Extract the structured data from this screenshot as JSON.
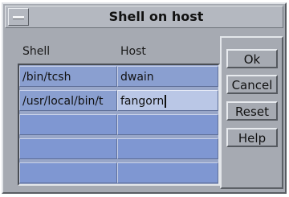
{
  "window": {
    "title": "Shell on host"
  },
  "table": {
    "headers": [
      "Shell",
      "Host"
    ],
    "rows": [
      [
        "/bin/tcsh",
        "dwain"
      ],
      [
        "/usr/local/bin/t",
        "fangorn"
      ],
      [
        "",
        ""
      ],
      [
        "",
        ""
      ],
      [
        "",
        ""
      ]
    ]
  },
  "buttons": {
    "ok": "Ok",
    "cancel": "Cancel",
    "reset": "Reset",
    "help": "Help"
  },
  "icons": {
    "window_menu": "window-menu-icon",
    "text_cursor": "text-cursor-icon"
  },
  "colors": {
    "window_bg": "#a6aab2",
    "cell_bg": "#8a9fd0",
    "editing_cell_bg": "#bac7e6"
  }
}
